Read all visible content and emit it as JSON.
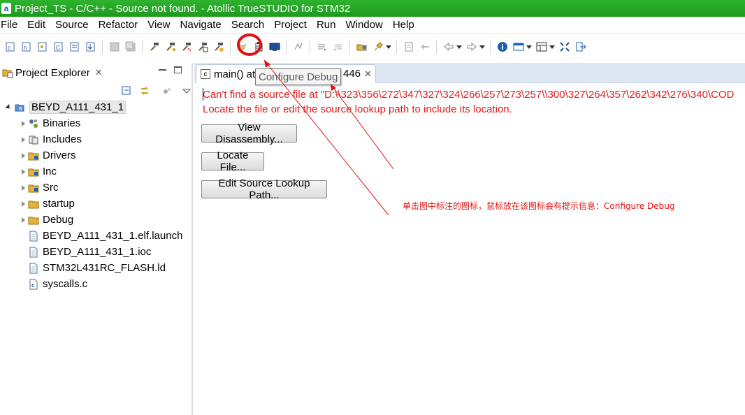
{
  "window": {
    "title": "Project_TS - C/C++ - Source not found. - Atollic TrueSTUDIO for STM32",
    "app_icon": "a"
  },
  "menu": [
    "File",
    "Edit",
    "Source",
    "Refactor",
    "View",
    "Navigate",
    "Search",
    "Project",
    "Run",
    "Window",
    "Help"
  ],
  "toolbar": {
    "icons": [
      "new-c-project-icon",
      "new-header-icon",
      "new-source-icon",
      "new-class-icon",
      "new-file-icon",
      "import-icon",
      "save-icon",
      "save-all-icon",
      "build-icon",
      "build-all-icon",
      "clean-icon",
      "rebuild-icon",
      "build-config-icon",
      "debug-icon",
      "configure-debug-icon",
      "terminal-icon",
      "link-icon",
      "next-annotation-icon",
      "prev-annotation-icon",
      "open-folder-icon",
      "run-icon",
      "last-edit-icon",
      "back-icon",
      "forward-icon",
      "info-icon",
      "window-icon",
      "layout-icon",
      "maximize-icon",
      "exit-icon"
    ]
  },
  "explorer": {
    "title": "Project Explorer",
    "root": "BEYD_A111_431_1",
    "items": [
      {
        "label": "Binaries",
        "icon": "binaries-icon",
        "expandable": true
      },
      {
        "label": "Includes",
        "icon": "includes-icon",
        "expandable": true
      },
      {
        "label": "Drivers",
        "icon": "folder-icon",
        "expandable": true
      },
      {
        "label": "Inc",
        "icon": "folder-icon",
        "expandable": true
      },
      {
        "label": "Src",
        "icon": "folder-icon",
        "expandable": true
      },
      {
        "label": "startup",
        "icon": "folder-icon",
        "expandable": true
      },
      {
        "label": "Debug",
        "icon": "folder-icon",
        "expandable": true
      },
      {
        "label": "BEYD_A111_431_1.elf.launch",
        "icon": "file-icon",
        "expandable": false
      },
      {
        "label": "BEYD_A111_431_1.ioc",
        "icon": "file-icon",
        "expandable": false
      },
      {
        "label": "STM32L431RC_FLASH.ld",
        "icon": "file-icon",
        "expandable": false
      },
      {
        "label": "syscalls.c",
        "icon": "c-file-icon",
        "expandable": false
      }
    ]
  },
  "editor": {
    "tab_label": "main() at",
    "tab_label_tail": "446",
    "error_line1": "Can't find a source file at \"D:\\\\323\\356\\272\\347\\327\\324\\266\\257\\273\\257\\\\300\\327\\264\\357\\262\\342\\276\\340\\COD",
    "error_line2": "Locate the file or edit the source lookup path to include its location.",
    "buttons": {
      "disassembly": "View Disassembly...",
      "locate": "Locate File...",
      "lookup": "Edit Source Lookup Path..."
    }
  },
  "tooltip": "Configure Debug",
  "annotation": {
    "note": "单击图中标注的图标，鼠标放在该图标会有提示信息：Configure Debug",
    "color": "#e01010"
  }
}
